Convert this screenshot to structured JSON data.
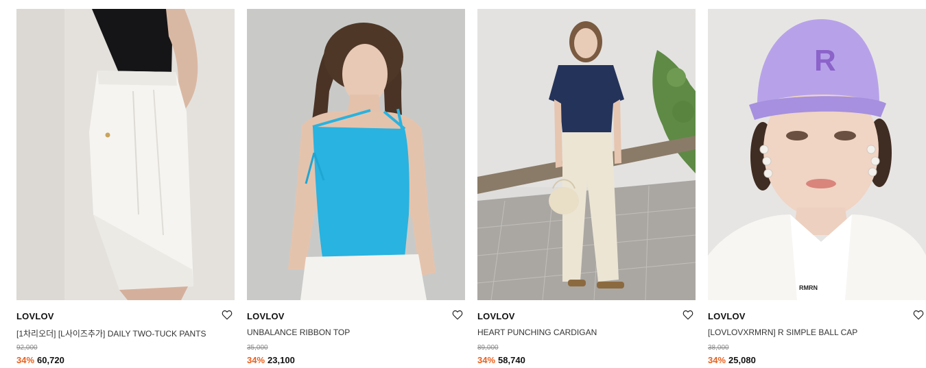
{
  "products": [
    {
      "brand": "LOVLOV",
      "name": "[1차리오더] [L사이즈추가] DAILY TWO-TUCK PANTS",
      "original_price": "92,000",
      "discount": "34%",
      "sale_price": "60,720",
      "image": "white-two-tuck-pants-photo"
    },
    {
      "brand": "LOVLOV",
      "name": "UNBALANCE RIBBON TOP",
      "original_price": "35,000",
      "discount": "34%",
      "sale_price": "23,100",
      "image": "blue-ribbon-top-photo"
    },
    {
      "brand": "LOVLOV",
      "name": "HEART PUNCHING CARDIGAN",
      "original_price": "89,000",
      "discount": "34%",
      "sale_price": "58,740",
      "image": "navy-cardigan-photo"
    },
    {
      "brand": "LOVLOV",
      "name": "[LOVLOVXRMRN] R SIMPLE BALL CAP",
      "original_price": "38,000",
      "discount": "34%",
      "sale_price": "25,080",
      "image": "lavender-ball-cap-photo",
      "image_text": {
        "cap_logo": "R",
        "shirt_print": "RMRN"
      }
    }
  ],
  "icons": {
    "wishlist": "heart-outline-icon"
  },
  "colors": {
    "discount": "#e9611e",
    "price": "#111111",
    "original_price": "#888888"
  }
}
